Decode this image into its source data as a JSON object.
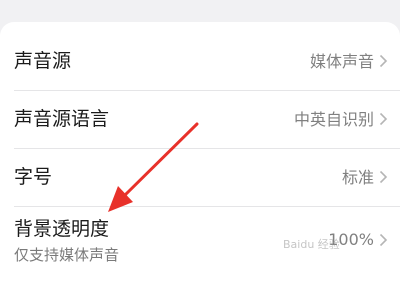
{
  "settings": {
    "items": [
      {
        "title": "声音源",
        "value": "媒体声音"
      },
      {
        "title": "声音源语言",
        "value": "中英自识别"
      },
      {
        "title": "字号",
        "value": "标准"
      },
      {
        "title": "背景透明度",
        "subtitle": "仅支持媒体声音",
        "value": "100%"
      }
    ]
  },
  "annotation": {
    "arrow_color": "#e8312a"
  },
  "watermark": {
    "text": "Baidu 经验"
  }
}
